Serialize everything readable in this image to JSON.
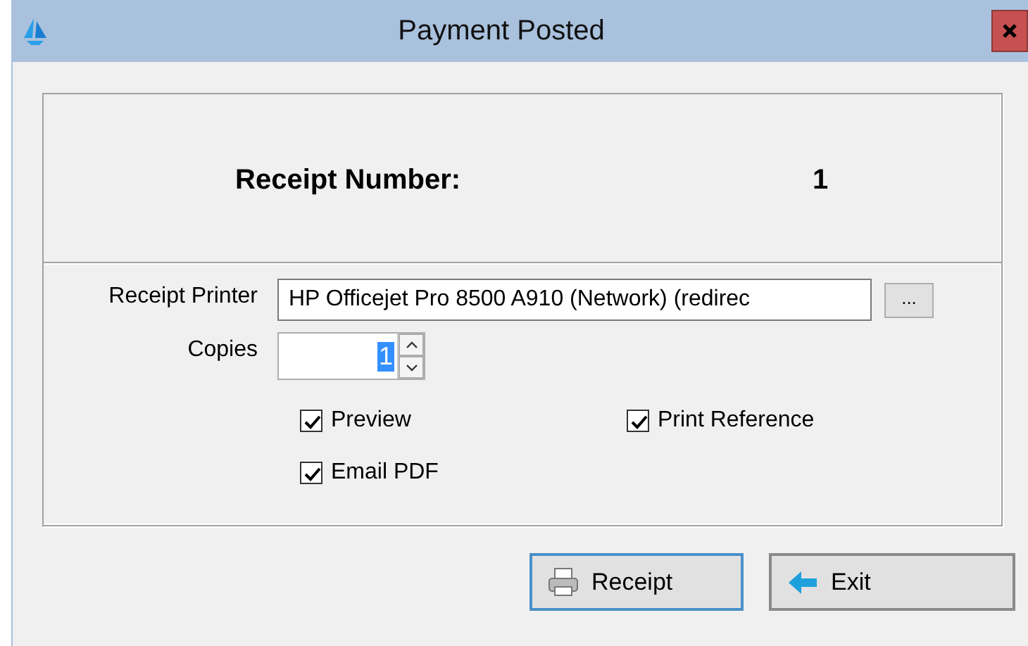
{
  "window": {
    "title": "Payment Posted"
  },
  "receipt": {
    "label": "Receipt Number:",
    "value": "1"
  },
  "printer": {
    "label": "Receipt Printer",
    "value": "HP Officejet Pro 8500 A910 (Network) (redirec",
    "browse": "..."
  },
  "copies": {
    "label": "Copies",
    "value": "1",
    "value_selected": true
  },
  "options": [
    {
      "label": "Preview",
      "checked": true
    },
    {
      "label": "Print Reference",
      "checked": true
    },
    {
      "label": "Email PDF",
      "checked": true
    }
  ],
  "buttons": [
    {
      "label": "Receipt",
      "kind": "print"
    },
    {
      "label": "Exit",
      "kind": "back"
    }
  ]
}
